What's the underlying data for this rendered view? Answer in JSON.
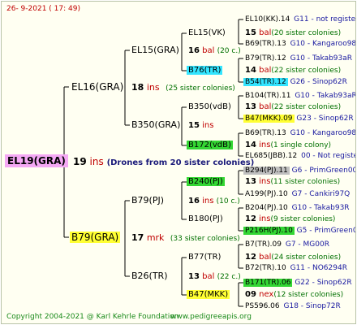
{
  "header": {
    "text": "26-  9-2021  (  17:  49)"
  },
  "footer": {
    "copyright": "Copyright 2004-2021 @ Karl Kehrle Foundation",
    "website": "www.pedigreeapis.org"
  },
  "colors": {
    "main_bg": "#f4a8f4",
    "yellow": "#ffff33",
    "cyan": "#33e5ff",
    "green": "#33d633",
    "grey": "#bfbfbf"
  },
  "root": {
    "name": "EL19(GRA)",
    "num": "19",
    "ins": "ins",
    "note": "(Drones from 20 sister colonies)"
  },
  "gen1": [
    {
      "name": "EL16(GRA)",
      "num": "18",
      "ins": "ins",
      "note": "(25 sister colonies)"
    },
    {
      "name": "B79(GRA)",
      "num": "17",
      "ins": "mrk",
      "note": "(33 sister colonies)"
    }
  ],
  "gen2": [
    {
      "name": "EL15(GRA)",
      "num": "16",
      "ins": "bal",
      "note": "(20 c.)"
    },
    {
      "name": "B350(GRA)",
      "num": "15",
      "ins": "ins",
      "note": ""
    },
    {
      "name": "B79(PJ)",
      "num": "16",
      "ins": "ins",
      "note": "(10 c.)"
    },
    {
      "name": "B26(TR)",
      "num": "13",
      "ins": "bal",
      "note": "(22 c.)"
    }
  ],
  "gen3": [
    {
      "name": "EL15(VK)",
      "num": "15",
      "ins": "bal",
      "note": "(20 sister colonies)"
    },
    {
      "name": "B76(TR)",
      "num": "14",
      "ins": "bal",
      "note": "(22 sister colonies)"
    },
    {
      "name": "B350(vdB)",
      "num": "13",
      "ins": "bal",
      "note": "(22 sister colonies)"
    },
    {
      "name": "B172(vdB)",
      "num": "14",
      "ins": "ins",
      "note": "(1 single colony)"
    },
    {
      "name": "B240(PJ)",
      "num": "13",
      "ins": "ins",
      "note": "(11 sister colonies)"
    },
    {
      "name": "B180(PJ)",
      "num": "12",
      "ins": "ins",
      "note": "(9 sister colonies)"
    },
    {
      "name": "B77(TR)",
      "num": "12",
      "ins": "bal",
      "note": "(24 sister colonies)"
    },
    {
      "name": "B47(MKK)",
      "num": "09",
      "ins": "nex",
      "note": "(12 sister colonies)"
    }
  ],
  "gen4": [
    {
      "name": "EL10(KK).14",
      "code": "G11 - not registe"
    },
    {
      "name": "B69(TR).13",
      "code": "G10 - Kangaroo98R"
    },
    {
      "name": "B79(TR).12",
      "code": "G10 - Takab93aR"
    },
    {
      "name": "B54(TR).12",
      "code": "G26 - Sinop62R"
    },
    {
      "name": "B104(TR).11",
      "code": "G10 - Takab93aR"
    },
    {
      "name": "B47(MKK).09",
      "code": "G23 - Sinop62R"
    },
    {
      "name": "B69(TR).13",
      "code": "G10 - Kangaroo98R"
    },
    {
      "name": "EL685(JBB).12",
      "code": "00 - Not registe"
    },
    {
      "name": "B294(PJ).11",
      "code": "G6 - PrimGreen00"
    },
    {
      "name": "A199(PJ).10",
      "code": "G7 - Cankiri97Q"
    },
    {
      "name": "B204(PJ).10",
      "code": "G10 - Takab93R"
    },
    {
      "name": "P216H(PJ).10",
      "code": "G5 - PrimGreen00"
    },
    {
      "name": "B7(TR).09",
      "code": "G7 - MG00R"
    },
    {
      "name": "B72(TR).10",
      "code": "G11 - NO6294R"
    },
    {
      "name": "B171(TR).06",
      "code": "G22 - Sinop62R"
    },
    {
      "name": "PS596.06",
      "code": "G18 - Sinop72R"
    }
  ]
}
